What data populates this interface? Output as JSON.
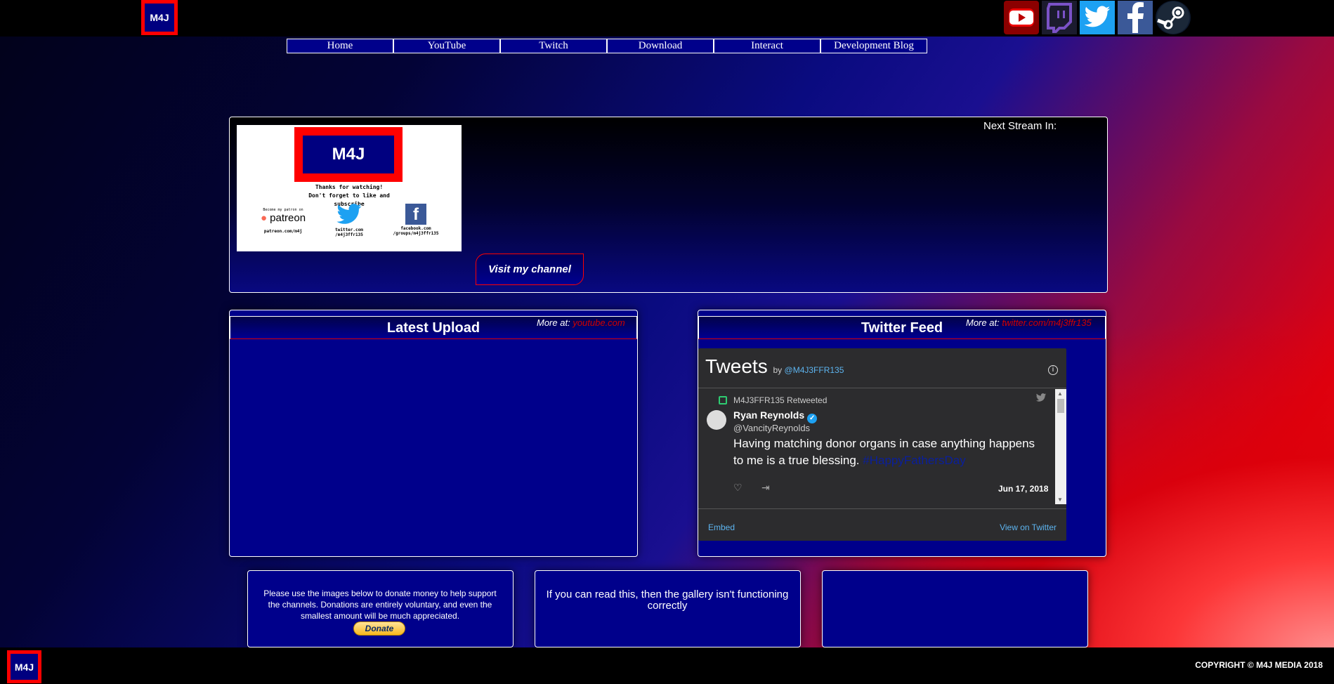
{
  "header": {
    "logo_text": "M4J",
    "social": [
      "youtube-icon",
      "twitch-icon",
      "twitter-icon",
      "facebook-icon",
      "steam-icon"
    ]
  },
  "nav": {
    "items": [
      {
        "label": "Home"
      },
      {
        "label": "YouTube"
      },
      {
        "label": "Twitch"
      },
      {
        "label": "Download"
      },
      {
        "label": "Interact"
      },
      {
        "label": "Development Blog"
      }
    ]
  },
  "hero": {
    "thumbnail": {
      "logo_text": "M4J",
      "line1": "Thanks for watching!",
      "line2": "Don't forget to like and",
      "line3": "subscribe",
      "patreon_caption": "Become my patron on",
      "patreon_word": "patreon",
      "patreon_url": "patreon.com/m4j",
      "twitter_url_1": "twitter.com",
      "twitter_url_2": "/m4j3ffr135",
      "facebook_url_1": "facebook.com",
      "facebook_url_2": "/groups/m4j3ffr135"
    },
    "next_stream_label": "Next Stream In:",
    "visit_button": "Visit my channel"
  },
  "latest_upload": {
    "title": "Latest Upload",
    "more_label": "More at:",
    "more_link": "youtube.com"
  },
  "twitter_feed": {
    "title": "Twitter Feed",
    "more_label": "More at:",
    "more_link": "twitter.com/m4j3ffr135",
    "embed": {
      "heading": "Tweets",
      "by": "by",
      "handle": "@M4J3FFR135",
      "retweeted_by": "M4J3FFR135 Retweeted",
      "author_name": "Ryan Reynolds",
      "author_handle": "@VancityReynolds",
      "text": "Having matching donor organs in case anything happens to me is a true blessing.",
      "hashtag": "#HappyFathersDay",
      "date": "Jun 17, 2018",
      "embed_link": "Embed",
      "view_link": "View on Twitter"
    }
  },
  "donate": {
    "text": "Please use the images below to donate money to help support the channels. Donations are entirely voluntary, and even the smallest amount will be much appreciated.",
    "button": "Donate"
  },
  "gallery": {
    "text": "If you can read this, then the gallery isn't functioning correctly"
  },
  "footer": {
    "logo_text": "M4J",
    "copyright": "COPYRIGHT © M4J MEDIA 2018"
  }
}
